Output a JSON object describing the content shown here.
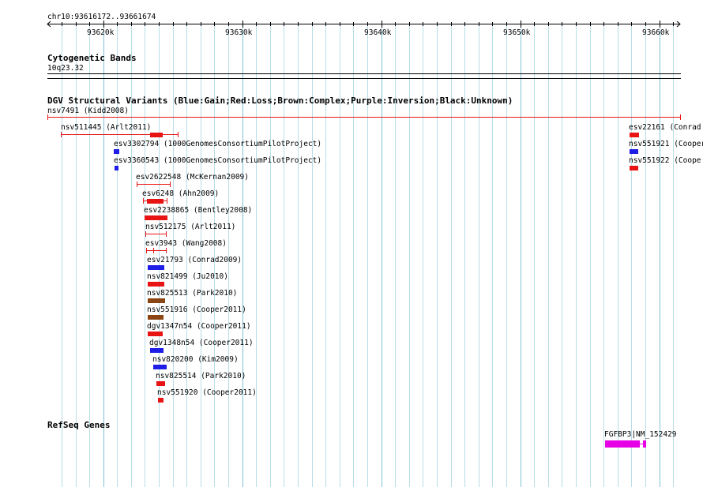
{
  "region": {
    "label": "chr10:93616172..93661674"
  },
  "ruler": {
    "ticks": [
      "93620k",
      "93630k",
      "93640k",
      "93650k",
      "93660k"
    ]
  },
  "cytoband": {
    "title": "Cytogenetic Bands",
    "band": "10q23.32"
  },
  "dgv": {
    "title": "DGV Structural Variants (Blue:Gain;Red:Loss;Brown:Complex;Purple:Inversion;Black:Unknown)",
    "colors": {
      "gain": "#1e1ee6",
      "loss": "#e81414",
      "complex": "#8b4513"
    },
    "variants": [
      {
        "label": "nsv7491 (Kidd2008)"
      },
      {
        "label": "nsv511445 (Arlt2011)"
      },
      {
        "label": "esv22161 (Conrad"
      },
      {
        "label": "esv3302794 (1000GenomesConsortiumPilotProject)"
      },
      {
        "label": "nsv551921 (Cooper"
      },
      {
        "label": "esv3360543 (1000GenomesConsortiumPilotProject)"
      },
      {
        "label": "nsv551922 (Coope"
      },
      {
        "label": "esv2622548 (McKernan2009)"
      },
      {
        "label": "esv6248 (Ahn2009)"
      },
      {
        "label": "esv2238865 (Bentley2008)"
      },
      {
        "label": "nsv512175 (Arlt2011)"
      },
      {
        "label": "esv3943 (Wang2008)"
      },
      {
        "label": "esv21793 (Conrad2009)"
      },
      {
        "label": "nsv821499 (Ju2010)"
      },
      {
        "label": "nsv825513 (Park2010)"
      },
      {
        "label": "nsv551916 (Cooper2011)"
      },
      {
        "label": "dgv1347n54 (Cooper2011)"
      },
      {
        "label": "dgv1348n54 (Cooper2011)"
      },
      {
        "label": "nsv820200 (Kim2009)"
      },
      {
        "label": "nsv825514 (Park2010)"
      },
      {
        "label": "nsv551920 (Cooper2011)"
      }
    ]
  },
  "refseq": {
    "title": "RefSeq Genes",
    "gene": "FGFBP3|NM_152429",
    "color": "#e600e6"
  }
}
